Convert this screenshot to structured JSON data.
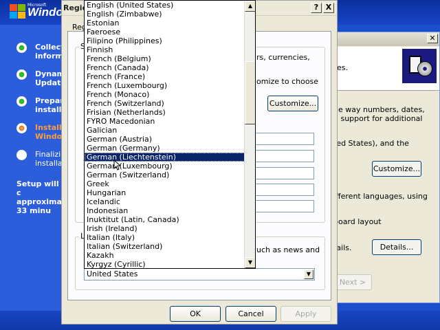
{
  "setup": {
    "brand_small": "Microsoft",
    "brand": "Windo",
    "steps": [
      {
        "label": "Collect\ninform",
        "state": "done"
      },
      {
        "label": "Dynam\nUpdate",
        "state": "done"
      },
      {
        "label": "Prepar\ninstalla",
        "state": "done"
      },
      {
        "label": "Install\nWindo",
        "state": "active"
      },
      {
        "label": "Finalizi\ninstalla",
        "state": "pending"
      }
    ],
    "time_remaining": "Setup will c\napproximat\n33 minu"
  },
  "wizard": {
    "header_text": "ges.",
    "body_text_1": "ne way numbers, dates,\nd support for additional",
    "body_text_2": "ted States), and the",
    "customize_label": "Customize...",
    "body_text_3": "ifferent languages, using",
    "body_text_4": "board layout",
    "body_text_5": "tails.",
    "details_label": "Details...",
    "next_label": "Next >"
  },
  "dialog": {
    "title": "Regio",
    "help_label": "?",
    "close_label": "X",
    "tab_label": "Reg",
    "group1_label": "S",
    "text1": "rs, currencies,",
    "text2": "omize to choose",
    "customize_label": "Customize...",
    "group2_label": "L",
    "text3": "uch as news and",
    "ok_label": "OK",
    "cancel_label": "Cancel",
    "apply_label": "Apply"
  },
  "location": {
    "selected_value": "United States",
    "items": [
      "English (United States)",
      "English (Zimbabwe)",
      "Estonian",
      "Faeroese",
      "Filipino (Philippines)",
      "Finnish",
      "French (Belgium)",
      "French (Canada)",
      "French (France)",
      "French (Luxembourg)",
      "French (Monaco)",
      "French (Switzerland)",
      "Frisian (Netherlands)",
      "FYRO Macedonian",
      "Galician",
      "German (Austria)",
      "German (Germany)",
      "German (Liechtenstein)",
      "German (Luxembourg)",
      "German (Switzerland)",
      "Greek",
      "Hungarian",
      "Icelandic",
      "Indonesian",
      "Inuktitut (Latin, Canada)",
      "Irish (Ireland)",
      "Italian (Italy)",
      "Italian (Switzerland)",
      "Kazakh",
      "Kyrgyz (Cyrillic)"
    ],
    "highlighted_item": "German (Liechtenstein)"
  }
}
